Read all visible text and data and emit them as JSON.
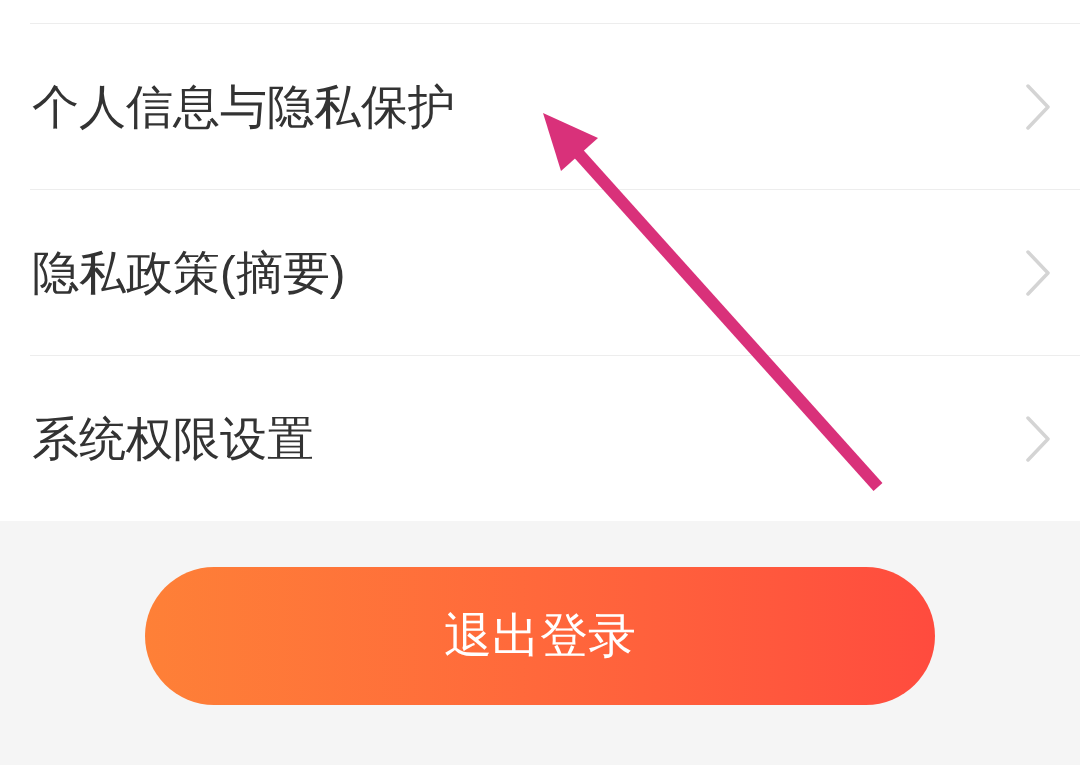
{
  "menu_items": [
    {
      "label": "个人信息与隐私保护"
    },
    {
      "label": "隐私政策(摘要)"
    },
    {
      "label": "系统权限设置"
    }
  ],
  "logout_button": {
    "label": "退出登录"
  }
}
